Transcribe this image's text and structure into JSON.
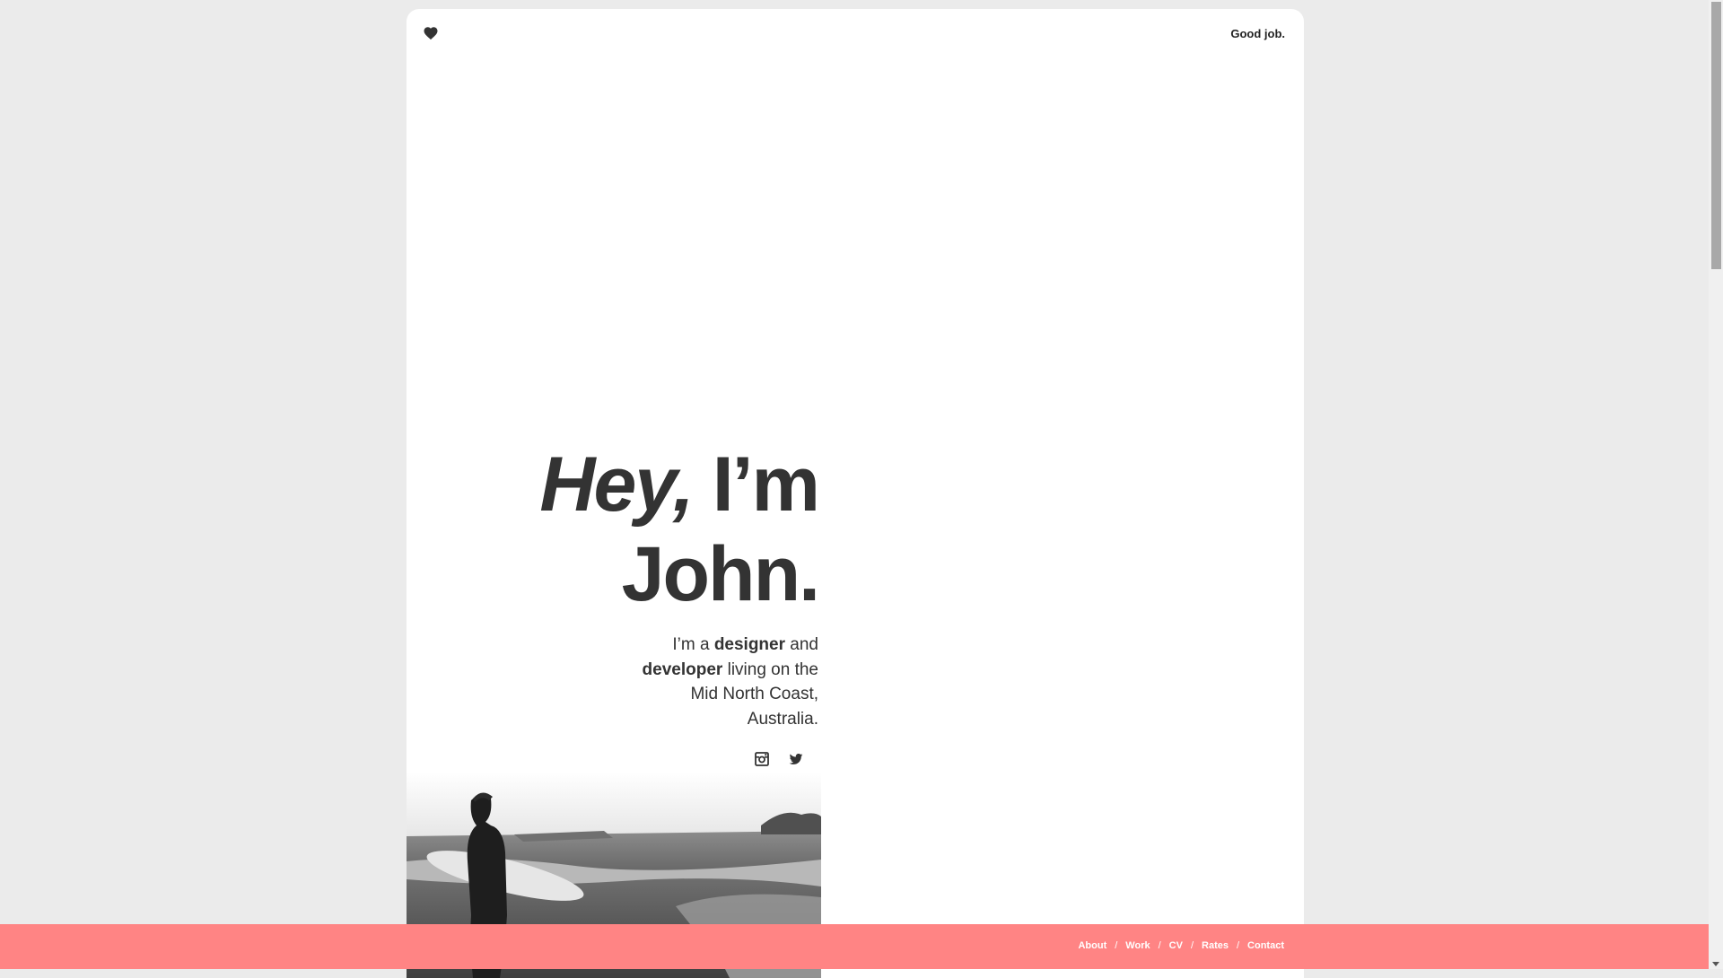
{
  "header": {
    "logo_icon": "heart-icon",
    "tagline": "Good job."
  },
  "hero": {
    "greeting": "Hey,",
    "greeting_rest": "I’m",
    "name": "John.",
    "intro_prefix": "I’m a ",
    "role_one": "designer",
    "intro_and": " and ",
    "role_two": "developer",
    "intro_suffix": " living on the Mid North Coast, Australia."
  },
  "social": {
    "instagram_icon": "instagram-icon",
    "twitter_icon": "twitter-icon"
  },
  "footer": {
    "nav": [
      "About",
      "Work",
      "CV",
      "Rates",
      "Contact"
    ],
    "separator": "/",
    "background": "#ff8484"
  },
  "colors": {
    "page_background": "#ebebeb",
    "text": "#333333",
    "accent": "#ff8484"
  }
}
